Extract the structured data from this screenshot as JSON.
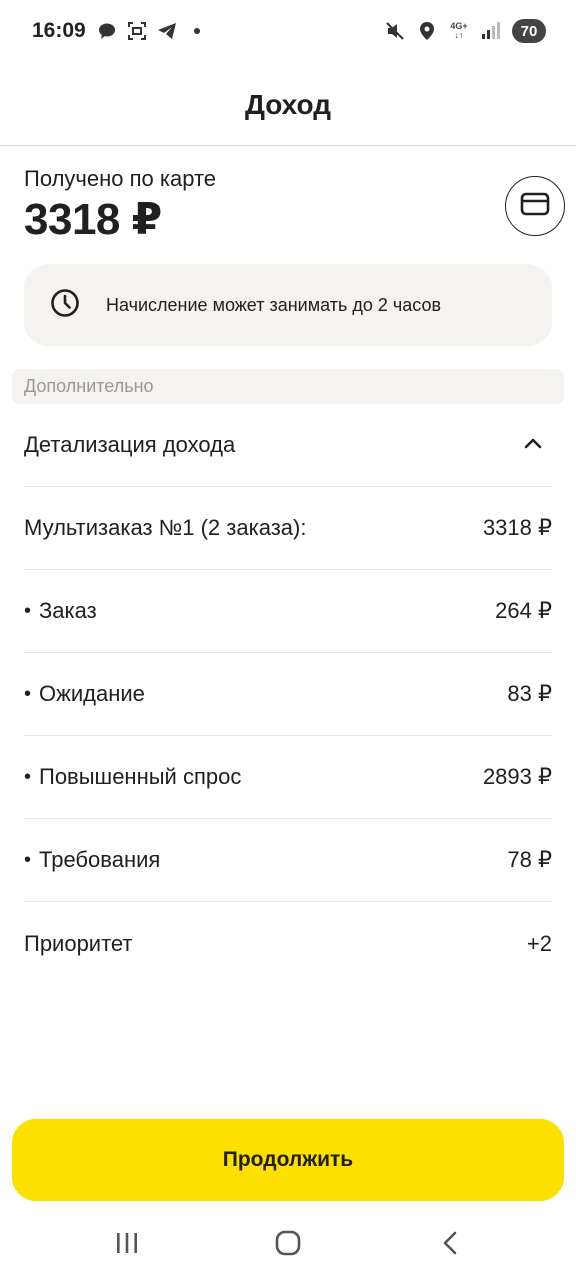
{
  "status_bar": {
    "time": "16:09",
    "left_icons": [
      "chat-bubble-icon",
      "screenshot-icon",
      "telegram-icon",
      "dot-icon"
    ],
    "right_icons": [
      "mute-icon",
      "location-icon",
      "network-icon",
      "signal-icon"
    ],
    "network_top": "4G+",
    "network_bottom": "↓↑",
    "battery": "70"
  },
  "header": {
    "title": "Доход"
  },
  "summary": {
    "label": "Получено по карте",
    "amount": "3318 ₽",
    "card_icon": "credit-card-icon"
  },
  "info": {
    "icon": "clock-icon",
    "text": "Начисление может занимать до 2 часов"
  },
  "section": {
    "title": "Дополнительно"
  },
  "details": {
    "title": "Детализация дохода",
    "expanded": true,
    "rows": [
      {
        "bullet": "",
        "label": "Мультизаказ №1 (2 заказа):",
        "value": "3318 ₽"
      },
      {
        "bullet": "•",
        "label": "Заказ",
        "value": "264 ₽"
      },
      {
        "bullet": "•",
        "label": "Ожидание",
        "value": "83 ₽"
      },
      {
        "bullet": "•",
        "label": "Повышенный спрос",
        "value": "2893 ₽"
      },
      {
        "bullet": "•",
        "label": "Требования",
        "value": "78 ₽"
      },
      {
        "bullet": "",
        "label": "Приоритет",
        "value": "+2"
      }
    ]
  },
  "footer": {
    "continue_label": "Продолжить"
  },
  "colors": {
    "accent": "#fce000",
    "text": "#21201f",
    "muted": "#9a9896",
    "panel": "#f4f3f0"
  }
}
